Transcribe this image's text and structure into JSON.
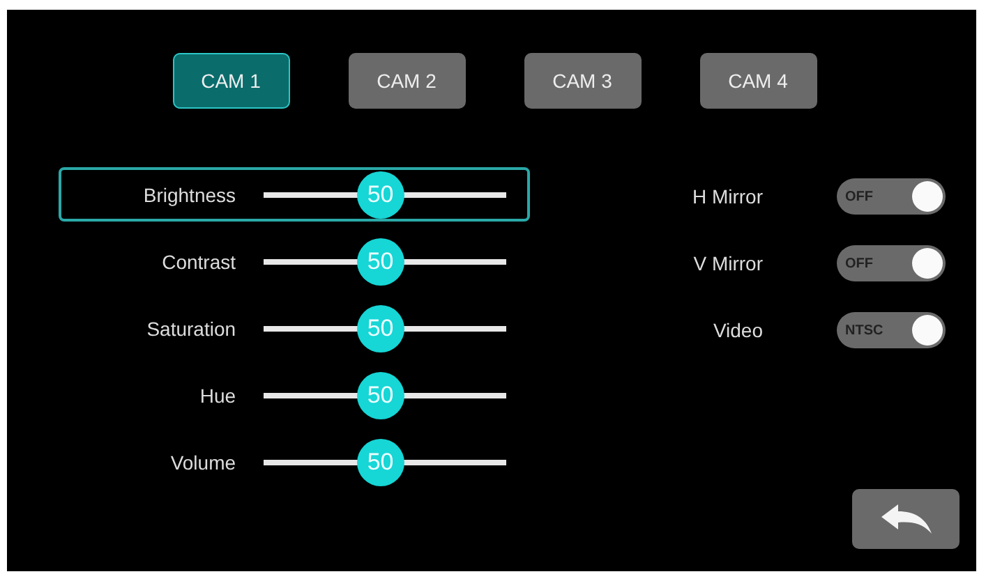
{
  "tabs": [
    {
      "label": "CAM 1",
      "selected": true
    },
    {
      "label": "CAM 2",
      "selected": false
    },
    {
      "label": "CAM 3",
      "selected": false
    },
    {
      "label": "CAM 4",
      "selected": false
    }
  ],
  "sliders": [
    {
      "name": "Brightness",
      "selected": true,
      "level": 0.47,
      "reading": "50"
    },
    {
      "name": "Contrast",
      "selected": false,
      "level": 0.47,
      "reading": "50"
    },
    {
      "name": "Saturation",
      "selected": false,
      "level": 0.47,
      "reading": "50"
    },
    {
      "name": "Hue",
      "selected": false,
      "level": 0.47,
      "reading": "50"
    },
    {
      "name": "Volume",
      "selected": false,
      "level": 0.47,
      "reading": "50"
    }
  ],
  "switches": [
    {
      "name": "H Mirror",
      "state": "OFF",
      "on": false
    },
    {
      "name": "V Mirror",
      "state": "OFF",
      "on": false
    },
    {
      "name": "Video",
      "state": "NTSC",
      "on": false
    }
  ]
}
